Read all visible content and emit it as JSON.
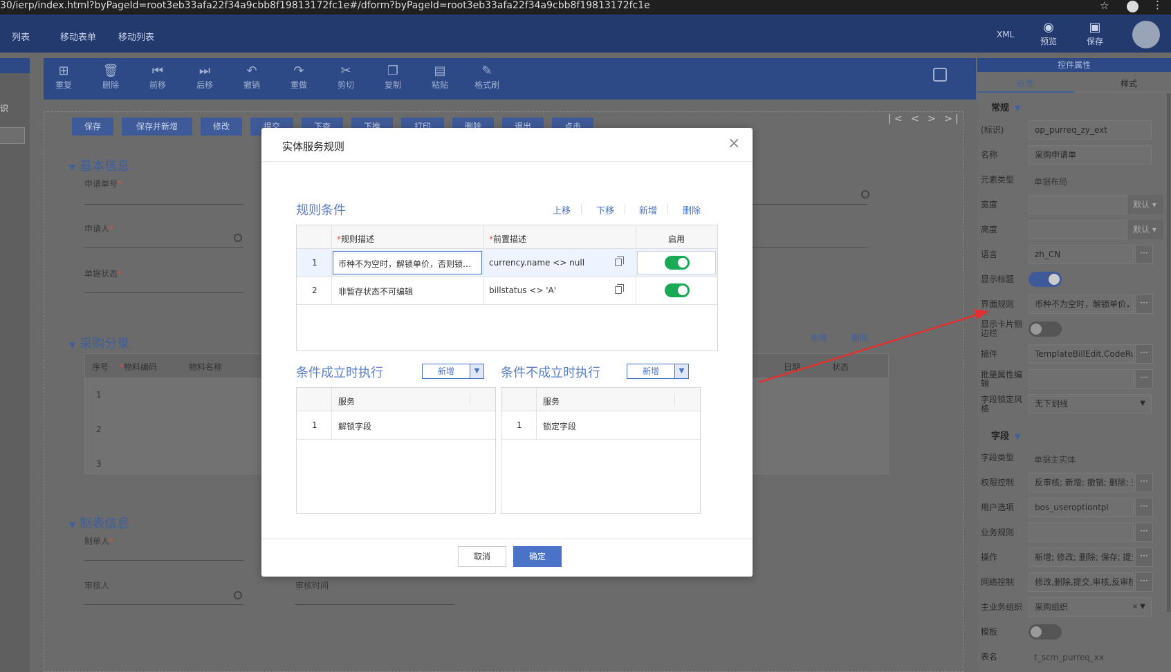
{
  "browser": {
    "url": "30/ierp/index.html?byPageId=root3eb33afa22f34a9cbb8f19813172fc1e#/dform?byPageId=root3eb33afa22f34a9cbb8f19813172fc1e"
  },
  "topnav": {
    "items": [
      "列表",
      "移动表单",
      "移动列表"
    ],
    "xml": "XML",
    "preview": "预览",
    "save": "保存"
  },
  "left": {
    "text": "识"
  },
  "toolbar": {
    "items": [
      "重复",
      "删除",
      "前移",
      "后移",
      "撤销",
      "重做",
      "剪切",
      "复制",
      "粘贴",
      "格式刷"
    ]
  },
  "form_buttons": [
    "保存",
    "保存并新增",
    "修改",
    "提交",
    "下查",
    "下推",
    "打印",
    "删除",
    "退出",
    "点击"
  ],
  "form": {
    "section1": "基本信息",
    "field_bill_no": "申请单号",
    "field_applicant": "申请人",
    "field_status": "单据状态",
    "section2": "采购分录",
    "grid_links": [
      "新增",
      "删除"
    ],
    "grid_headers": [
      "序号",
      "物料编码",
      "物料名称",
      "日期",
      "状态"
    ],
    "grid_rows": [
      "1",
      "2",
      "3"
    ],
    "section3": "制表信息",
    "field_creator": "制单人",
    "field_auditor": "审核人",
    "field_audit_time": "审核时间"
  },
  "rpanel": {
    "title": "控件属性",
    "tab_business": "业务",
    "tab_style": "样式",
    "group_general": "常规",
    "group_field": "字段",
    "default_label": "默认",
    "rows": {
      "id_label": "(标识)",
      "id_value": "op_purreq_zy_ext",
      "name_label": "名称",
      "name_value": "采购申请单",
      "elemtype_label": "元素类型",
      "elemtype_value": "单据布局",
      "width_label": "宽度",
      "height_label": "高度",
      "lang_label": "语言",
      "lang_value": "zh_CN",
      "showtitle_label": "显示标题",
      "uirule_label": "界面规则",
      "uirule_value": "币种不为空时，解锁单价，否",
      "cardborder_label": "显示卡片侧边栏",
      "plugin_label": "插件",
      "plugin_value": "TemplateBillEdit,CodeRule",
      "batch_label": "批量属性编辑",
      "lockstyle_label": "字段锁定风格",
      "lockstyle_value": "无下划线",
      "fieldtype_label": "字段类型",
      "fieldtype_value": "单据主实体",
      "perm_label": "权限控制",
      "perm_value": "反审核; 新增; 撤销; 删除; 查询",
      "useropt_label": "用户选项",
      "useropt_value": "bos_useroptiontpl",
      "bizrule_label": "业务规则",
      "ops_label": "操作",
      "ops_value": "新增; 修改; 删除; 保存; 提交;",
      "netctl_label": "网络控制",
      "netctl_value": "修改,删除,提交,审核,反审核,",
      "mainorg_label": "主业务组织",
      "mainorg_value": "采购组织",
      "template_label": "模板",
      "table_label": "表名",
      "table_value": "t_scm_purreq_xx"
    }
  },
  "modal": {
    "title": "实体服务规则",
    "rules_title": "规则条件",
    "rules_links": [
      "上移",
      "下移",
      "新增",
      "删除"
    ],
    "rules_headers": [
      "规则描述",
      "前置描述",
      "启用"
    ],
    "rules": [
      {
        "no": "1",
        "desc": "币种不为空时，解锁单价，否则锁定...",
        "pre": "currency.name <> null",
        "enabled": true
      },
      {
        "no": "2",
        "desc": "非暂存状态不可编辑",
        "pre": "billstatus <> 'A'",
        "enabled": true
      }
    ],
    "true_title": "条件成立时执行",
    "false_title": "条件不成立时执行",
    "add_label": "新增",
    "service_header": "服务",
    "true_rows": [
      {
        "no": "1",
        "service": "解锁字段"
      }
    ],
    "false_rows": [
      {
        "no": "1",
        "service": "锁定字段"
      }
    ],
    "cancel": "取消",
    "ok": "确定"
  }
}
